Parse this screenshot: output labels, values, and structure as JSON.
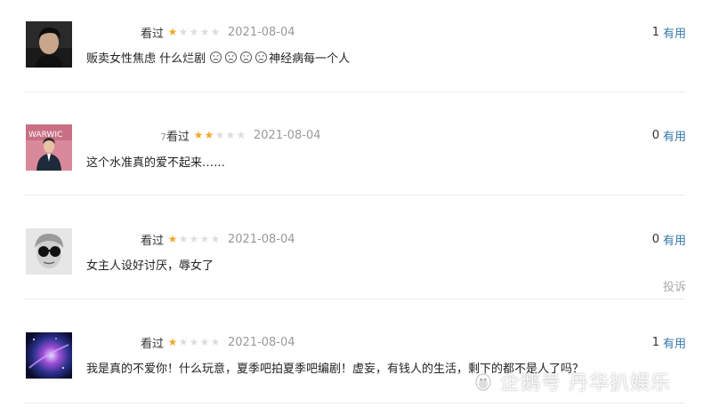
{
  "reviews": [
    {
      "status": "看过",
      "rating": 1,
      "date": "2021-08-04",
      "vote_count": "1",
      "vote_label": "有用",
      "content_before": "贩卖女性焦虑 什么烂剧",
      "content_emojis": [
        "angry-face-icon",
        "angry-face-icon",
        "angry-face-icon",
        "angry-face-icon"
      ],
      "content_after": "神经病每一个人"
    },
    {
      "status": "看过",
      "status_prefix": "7",
      "rating": 2,
      "date": "2021-08-04",
      "vote_count": "0",
      "vote_label": "有用",
      "content": "这个水准真的爱不起来……"
    },
    {
      "status": "看过",
      "rating": 1,
      "date": "2021-08-04",
      "vote_count": "0",
      "vote_label": "有用",
      "content": "女主人设好讨厌，辱女了",
      "report_label": "投诉"
    },
    {
      "status": "看过",
      "rating": 1,
      "date": "2021-08-04",
      "vote_count": "1",
      "vote_label": "有用",
      "content": "我是真的不爱你！什么玩意，夏季吧拍夏季吧编剧！虚妄，有钱人的生活，剩下的都不是人了吗？"
    }
  ],
  "watermark": "企鹅号 丹华扒娱乐",
  "colors": {
    "star_on": "#f4a82c",
    "star_off": "#dddddd",
    "link": "#3377aa",
    "date": "#999999",
    "divider": "#ececec"
  }
}
